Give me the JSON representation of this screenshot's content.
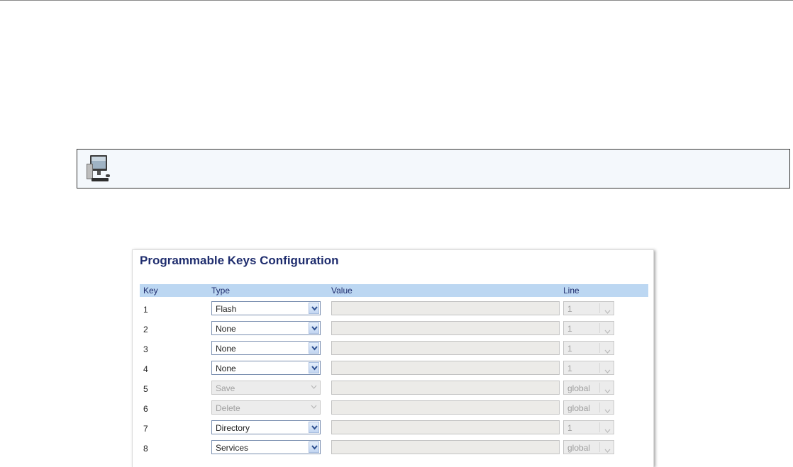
{
  "panel": {
    "title": "Programmable Keys Configuration",
    "columns": {
      "key": "Key",
      "type": "Type",
      "value": "Value",
      "line": "Line"
    },
    "rows": [
      {
        "key": "1",
        "type": "Flash",
        "type_enabled": true,
        "value": "",
        "line": "1"
      },
      {
        "key": "2",
        "type": "None",
        "type_enabled": true,
        "value": "",
        "line": "1"
      },
      {
        "key": "3",
        "type": "None",
        "type_enabled": true,
        "value": "",
        "line": "1"
      },
      {
        "key": "4",
        "type": "None",
        "type_enabled": true,
        "value": "",
        "line": "1"
      },
      {
        "key": "5",
        "type": "Save",
        "type_enabled": false,
        "value": "",
        "line": "global"
      },
      {
        "key": "6",
        "type": "Delete",
        "type_enabled": false,
        "value": "",
        "line": "global"
      },
      {
        "key": "7",
        "type": "Directory",
        "type_enabled": true,
        "value": "",
        "line": "1"
      },
      {
        "key": "8",
        "type": "Services",
        "type_enabled": true,
        "value": "",
        "line": "global"
      }
    ]
  },
  "note": {
    "icon": "desktop-computer-icon"
  },
  "colors": {
    "title": "#1f2d6e",
    "header_bg": "#bcd7f2",
    "note_bg": "#f4f8fc",
    "disabled_field": "#ececec"
  }
}
